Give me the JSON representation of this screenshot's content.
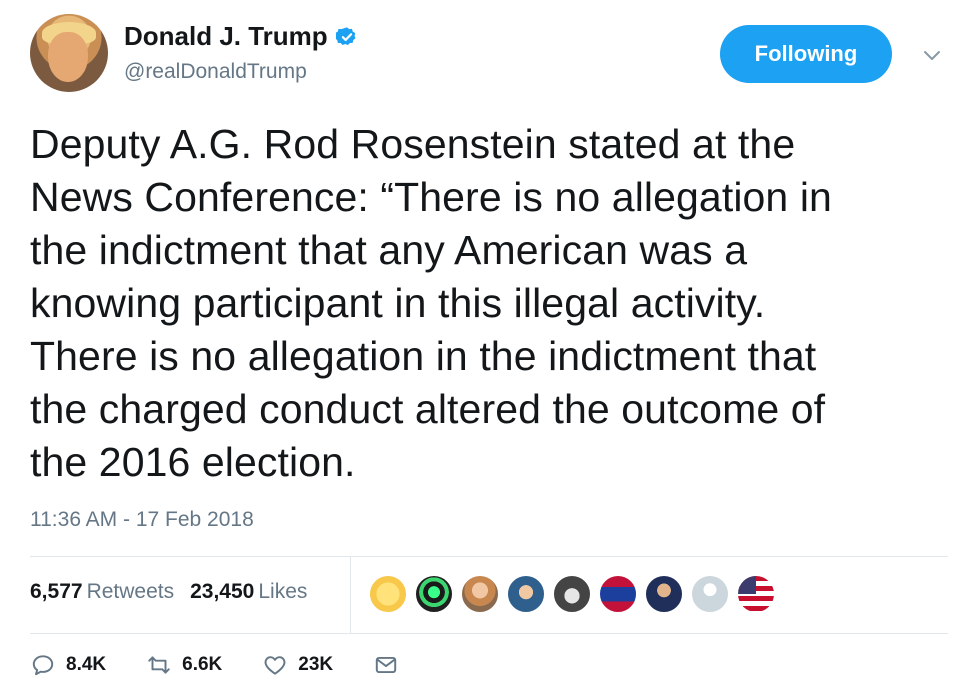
{
  "author": {
    "name": "Donald J. Trump",
    "handle": "@realDonaldTrump"
  },
  "follow_button": {
    "label": "Following"
  },
  "tweet": {
    "text_lines": [
      "Deputy A.G. Rod Rosenstein stated at the",
      "News Conference: “There is no allegation in",
      "the indictment that any American was a",
      "knowing participant in this illegal activity.",
      "There is no allegation in the indictment that",
      "the charged conduct altered the outcome of",
      "the 2016 election."
    ],
    "timestamp": "11:36 AM - 17 Feb 2018"
  },
  "stats": {
    "retweets_count": "6,577",
    "retweets_label": "Retweets",
    "likes_count": "23,450",
    "likes_label": "Likes"
  },
  "actions": {
    "replies": "8.4K",
    "retweets": "6.6K",
    "likes": "23K"
  },
  "colors": {
    "accent": "#1da1f2",
    "secondary_text": "#657786",
    "divider": "#e1e8ed"
  },
  "icons": [
    "verified-badge-icon",
    "chevron-down-icon",
    "reply-icon",
    "retweet-icon",
    "like-icon",
    "direct-message-icon"
  ]
}
